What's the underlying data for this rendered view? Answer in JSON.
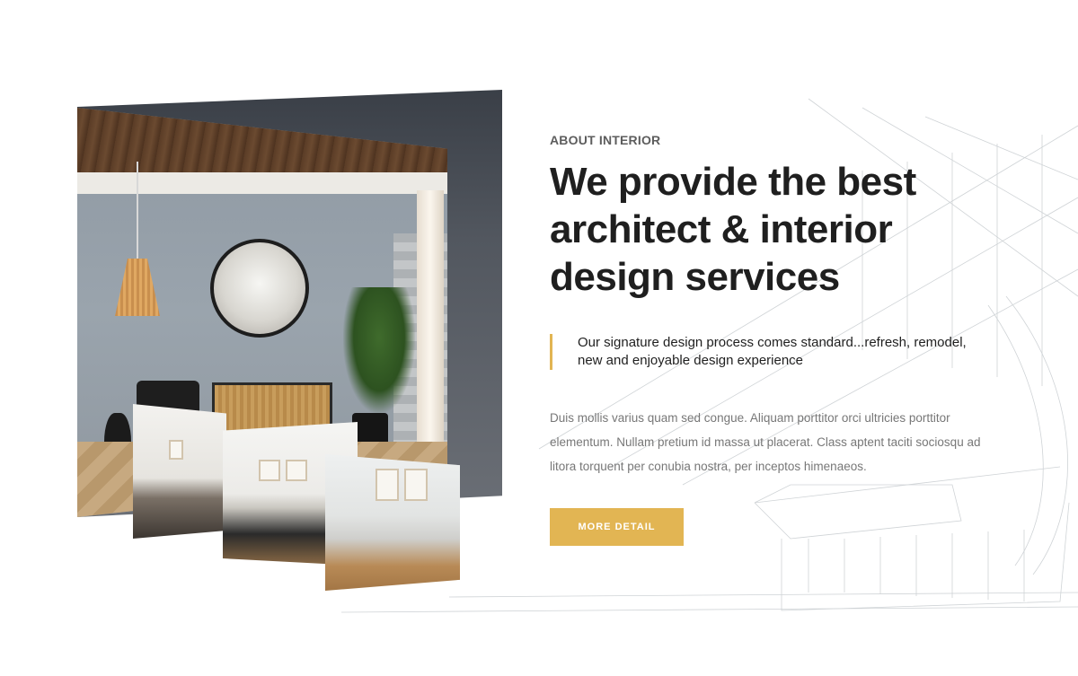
{
  "about": {
    "eyebrow": "ABOUT INTERIOR",
    "title": "We provide the best architect & interior design services",
    "quote": "Our signature design process comes standard...refresh, remodel, new and enjoyable design experience",
    "body": "Duis mollis varius quam sed congue. Aliquam porttitor orci ultricies porttitor elementum. Nullam pretium id massa ut placerat. Class aptent taciti sociosqu ad litora torquent per conubia nostra, per inceptos himenaeos.",
    "button_label": "MORE DETAIL"
  },
  "colors": {
    "accent": "#e2b553",
    "heading": "#1f1f1f",
    "body_text": "#777777"
  }
}
